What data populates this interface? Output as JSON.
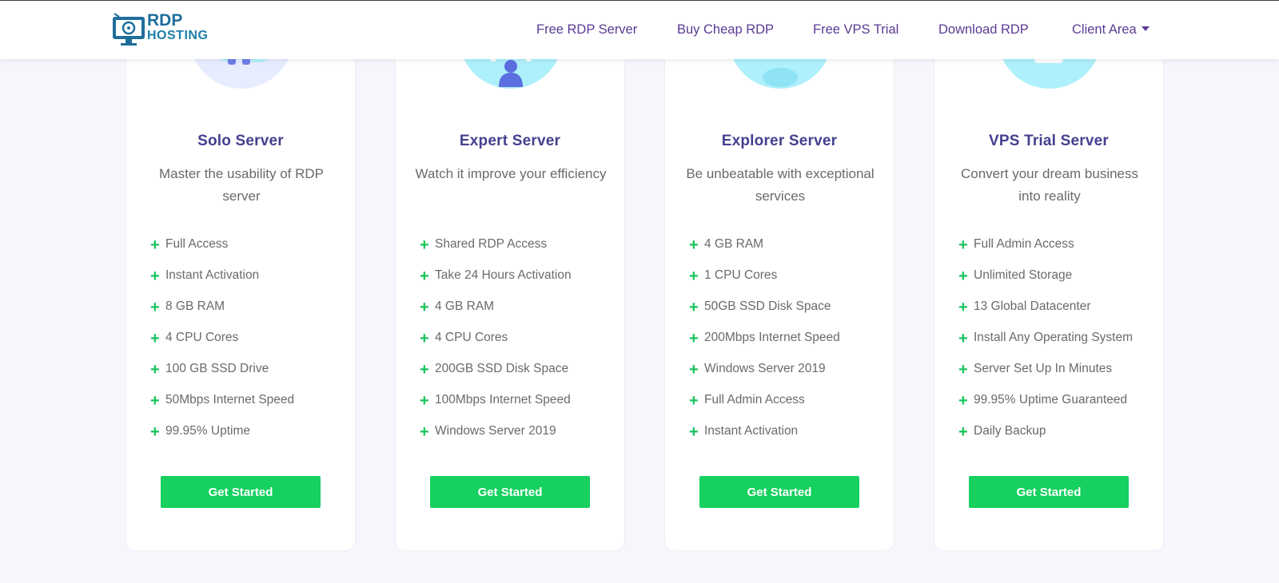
{
  "brand": {
    "line1": "RDP",
    "line2": "HOSTING"
  },
  "nav": [
    {
      "label": "Free RDP Server"
    },
    {
      "label": "Buy Cheap RDP"
    },
    {
      "label": "Free VPS Trial"
    },
    {
      "label": "Download RDP"
    },
    {
      "label": "Client Area"
    }
  ],
  "colors": {
    "accent": "#16d15f",
    "nav_text": "#5b3a94",
    "title": "#45408f",
    "illustration": "#aef0fb"
  },
  "plans": [
    {
      "title": "Solo Server",
      "description": "Master the usability of RDP server",
      "features": [
        "Full Access",
        "Instant Activation",
        "8 GB RAM",
        "4 CPU Cores",
        "100 GB SSD Drive",
        "50Mbps Internet Speed",
        "99.95% Uptime"
      ],
      "cta": "Get Started"
    },
    {
      "title": "Expert Server",
      "description": "Watch it improve your efficiency",
      "features": [
        "Shared RDP Access",
        "Take 24 Hours Activation",
        "4 GB RAM",
        "4 CPU Cores",
        "200GB SSD Disk Space",
        "100Mbps Internet Speed",
        "Windows Server 2019"
      ],
      "cta": "Get Started"
    },
    {
      "title": "Explorer Server",
      "description": "Be unbeatable with exceptional services",
      "features": [
        "4 GB RAM",
        "1 CPU Cores",
        "50GB SSD Disk Space",
        "200Mbps Internet Speed",
        "Windows Server 2019",
        "Full Admin Access",
        "Instant Activation"
      ],
      "cta": "Get Started"
    },
    {
      "title": "VPS Trial Server",
      "description": "Convert your dream business into reality",
      "features": [
        "Full Admin Access",
        "Unlimited Storage",
        "13 Global Datacenter",
        "Install Any Operating System",
        "Server Set Up In Minutes",
        "99.95% Uptime Guaranteed",
        "Daily Backup"
      ],
      "cta": "Get Started"
    }
  ]
}
